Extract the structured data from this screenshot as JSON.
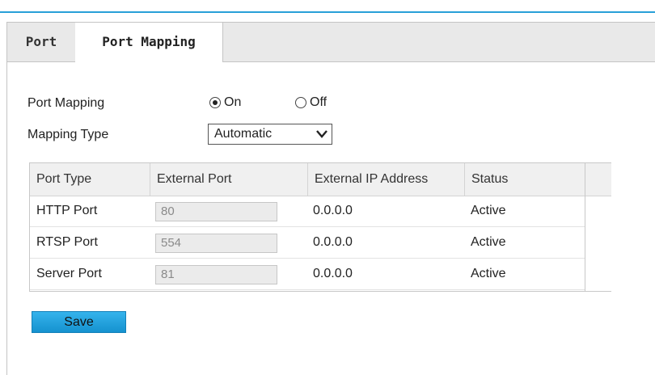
{
  "tabs": [
    {
      "label": "Port",
      "active": false
    },
    {
      "label": "Port Mapping",
      "active": true
    }
  ],
  "form": {
    "port_mapping_label": "Port Mapping",
    "options": [
      {
        "label": "On",
        "checked": true
      },
      {
        "label": "Off",
        "checked": false
      }
    ],
    "mapping_type_label": "Mapping Type",
    "mapping_type_value": "Automatic"
  },
  "table": {
    "columns": [
      "Port Type",
      "External Port",
      "External IP Address",
      "Status"
    ],
    "rows": [
      {
        "port_type": "HTTP Port",
        "external_port": "80",
        "external_ip": "0.0.0.0",
        "status": "Active"
      },
      {
        "port_type": "RTSP Port",
        "external_port": "554",
        "external_ip": "0.0.0.0",
        "status": "Active"
      },
      {
        "port_type": "Server Port",
        "external_port": "81",
        "external_ip": "0.0.0.0",
        "status": "Active"
      }
    ]
  },
  "save_label": "Save",
  "colors": {
    "accent": "#28a0d8",
    "button": "#1ea3e0"
  }
}
